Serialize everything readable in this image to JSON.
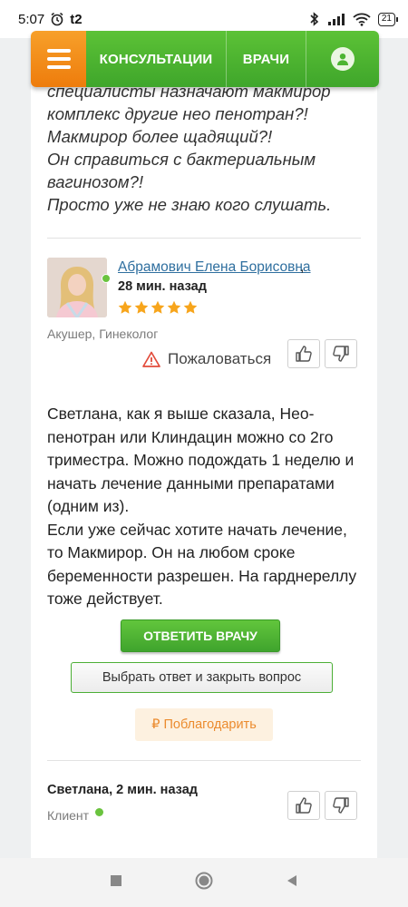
{
  "statusbar": {
    "time": "5:07",
    "carrier": "t2",
    "battery": "21"
  },
  "nav": {
    "menu_icon": "hamburger-menu-icon",
    "consultations": "КОНСУЛЬТАЦИИ",
    "doctors": "ВРАЧИ",
    "user_icon": "user-icon"
  },
  "question": {
    "lines": [
      "специалисты назначают макмирор",
      "комплекс другие нео пенотран?!",
      "Макмирор более щадящий?!",
      "Он справиться с бактериальным",
      "вагинозом?!",
      "Просто уже не знаю кого слушать."
    ]
  },
  "doctor": {
    "name": "Абрамович Елена Борисовна",
    "comma": ",",
    "time": "28 мин. назад",
    "rating": 5,
    "specialty": "Акушер, Гинеколог",
    "complain": "Пожаловаться"
  },
  "answer": {
    "p1": "Светлана, как я выше сказала, Нео-пенотран или Клиндацин можно со 2го триместра. Можно подождать 1 неделю и начать лечение данными препаратами (одним из).",
    "p2": "Если уже сейчас хотите начать лечение, то Макмирор. Он на любом сроке беременности разрешен. На гарднереллу тоже действует."
  },
  "buttons": {
    "reply": "ОТВЕТИТЬ ВРАЧУ",
    "choose": "Выбрать ответ и закрыть вопрос",
    "thank_symbol": "₽",
    "thank": "Поблагодарить"
  },
  "client": {
    "name": "Светлана, 2 мин. назад",
    "role": "Клиент"
  },
  "colors": {
    "green": "#4cb532",
    "orange": "#f08a1c",
    "link": "#2f6f9f"
  }
}
